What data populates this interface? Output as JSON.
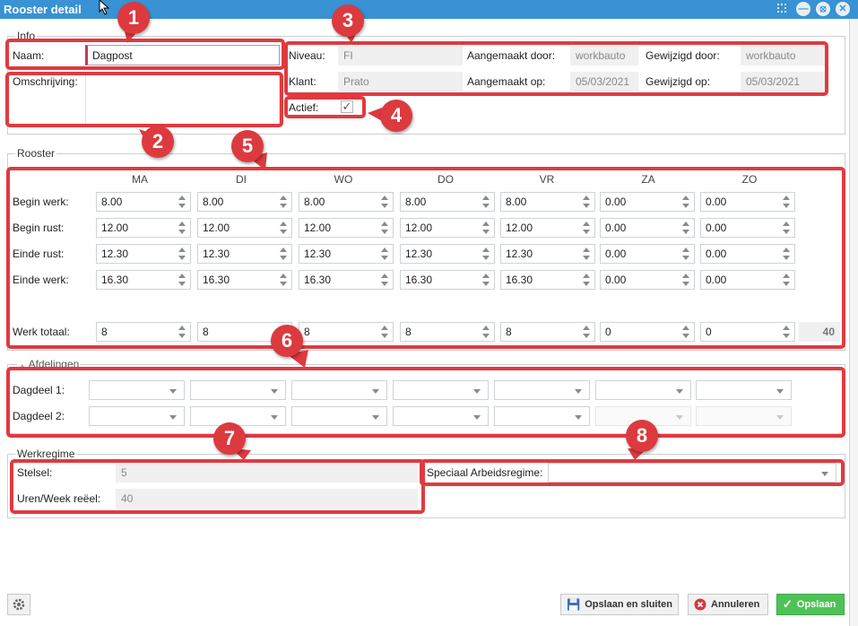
{
  "window": {
    "title": "Rooster detail"
  },
  "info": {
    "legend": "Info",
    "naam_label": "Naam:",
    "naam_value": "Dagpost",
    "omschrijving_label": "Omschrijving:",
    "omschrijving_value": "",
    "niveau_label": "Niveau:",
    "niveau_value": "FI",
    "klant_label": "Klant:",
    "klant_value": "Prato",
    "aangemaakt_door_label": "Aangemaakt door:",
    "aangemaakt_door_value": "workbauto",
    "aangemaakt_op_label": "Aangemaakt op:",
    "aangemaakt_op_value": "05/03/2021",
    "gewijzigd_door_label": "Gewijzigd door:",
    "gewijzigd_door_value": "workbauto",
    "gewijzigd_op_label": "Gewijzigd op:",
    "gewijzigd_op_value": "05/03/2021",
    "actief_label": "Actief:",
    "actief_checked": true
  },
  "rooster": {
    "legend": "Rooster",
    "days": [
      "MA",
      "DI",
      "WO",
      "DO",
      "VR",
      "ZA",
      "ZO"
    ],
    "rows": [
      {
        "label": "Begin werk:",
        "values": [
          "8.00",
          "8.00",
          "8.00",
          "8.00",
          "8.00",
          "0.00",
          "0.00"
        ]
      },
      {
        "label": "Begin rust:",
        "values": [
          "12.00",
          "12.00",
          "12.00",
          "12.00",
          "12.00",
          "0.00",
          "0.00"
        ]
      },
      {
        "label": "Einde rust:",
        "values": [
          "12.30",
          "12.30",
          "12.30",
          "12.30",
          "12.30",
          "0.00",
          "0.00"
        ]
      },
      {
        "label": "Einde werk:",
        "values": [
          "16.30",
          "16.30",
          "16.30",
          "16.30",
          "16.30",
          "0.00",
          "0.00"
        ]
      }
    ],
    "totaal": {
      "label": "Werk totaal:",
      "values": [
        "8",
        "8",
        "8",
        "8",
        "8",
        "0",
        "0"
      ],
      "sum": "40"
    }
  },
  "afdelingen": {
    "legend": "Afdelingen",
    "dagdeel1_label": "Dagdeel 1:",
    "dagdeel2_label": "Dagdeel 2:"
  },
  "werkregime": {
    "legend": "Werkregime",
    "stelsel_label": "Stelsel:",
    "stelsel_value": "5",
    "uren_label": "Uren/Week reëel:",
    "uren_value": "40",
    "speciaal_label": "Speciaal Arbeidsregime:",
    "speciaal_value": ""
  },
  "buttons": {
    "save_close": "Opslaan en sluiten",
    "cancel": "Annuleren",
    "save": "Opslaan"
  },
  "annotations": [
    "1",
    "2",
    "3",
    "4",
    "5",
    "6",
    "7",
    "8"
  ],
  "colors": {
    "titlebar": "#3892d3",
    "highlight": "#e03a40",
    "save_button": "#4fc257"
  }
}
